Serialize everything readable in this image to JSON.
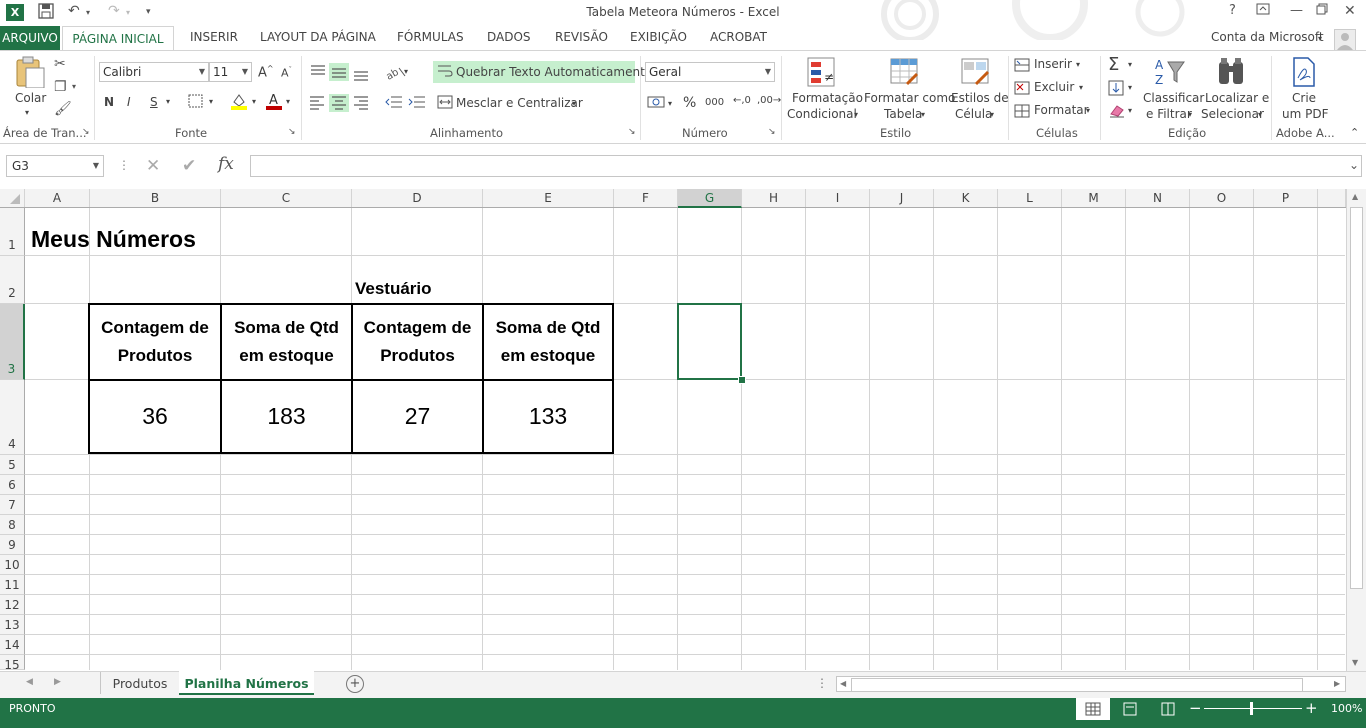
{
  "window": {
    "title": "Tabela Meteora Números - Excel",
    "help": "?",
    "account": "Conta da Microsoft"
  },
  "tabs": [
    "ARQUIVO",
    "PÁGINA INICIAL",
    "INSERIR",
    "LAYOUT DA PÁGINA",
    "FÓRMULAS",
    "DADOS",
    "REVISÃO",
    "EXIBIÇÃO",
    "ACROBAT"
  ],
  "ribbon": {
    "clipboard": {
      "paste": "Colar",
      "label": "Área de Tran..."
    },
    "font": {
      "name": "Calibri",
      "size": "11",
      "bold": "N",
      "italic": "I",
      "underline": "S",
      "label": "Fonte"
    },
    "alignment": {
      "wrap": "Quebrar Texto Automaticamente",
      "merge": "Mesclar e Centralizar",
      "label": "Alinhamento"
    },
    "number": {
      "format": "Geral",
      "percent": "%",
      "thousands": "000",
      "label": "Número"
    },
    "styles": {
      "conditional_1": "Formatação",
      "conditional_2": "Condicional",
      "table_1": "Formatar como",
      "table_2": "Tabela",
      "cell_1": "Estilos de",
      "cell_2": "Célula",
      "label": "Estilo"
    },
    "cells": {
      "insert": "Inserir",
      "delete": "Excluir",
      "format": "Formatar",
      "label": "Células"
    },
    "editing": {
      "sort_1": "Classificar",
      "sort_2": "e Filtrar",
      "find_1": "Localizar e",
      "find_2": "Selecionar",
      "label": "Edição"
    },
    "adobe": {
      "pdf_1": "Crie",
      "pdf_2": "um PDF",
      "label": "Adobe A..."
    }
  },
  "formula_bar": {
    "name_box": "G3",
    "fx": "fx",
    "value": ""
  },
  "columns": [
    "A",
    "B",
    "C",
    "D",
    "E",
    "F",
    "G",
    "H",
    "I",
    "J",
    "K",
    "L",
    "M",
    "N",
    "O",
    "P"
  ],
  "rows": [
    "1",
    "2",
    "3",
    "4",
    "5",
    "6",
    "7",
    "8",
    "9",
    "10",
    "11",
    "12",
    "13",
    "14",
    "15"
  ],
  "sheet": {
    "title": "Meus Números",
    "group_header": "Vestuário",
    "headers": [
      {
        "l1": "Contagem de",
        "l2": "Produtos"
      },
      {
        "l1": "Soma de Qtd",
        "l2": "em estoque"
      },
      {
        "l1": "Contagem de",
        "l2": "Produtos"
      },
      {
        "l1": "Soma de Qtd",
        "l2": "em estoque"
      }
    ],
    "values": [
      "36",
      "183",
      "27",
      "133"
    ]
  },
  "sheet_tabs": [
    "Produtos",
    "Planilha Números"
  ],
  "status": {
    "mode": "PRONTO",
    "zoom": "100%"
  },
  "colors": {
    "accent": "#217346",
    "active_tab_text": "#217346",
    "wrap_highlight": "#c6efce"
  }
}
